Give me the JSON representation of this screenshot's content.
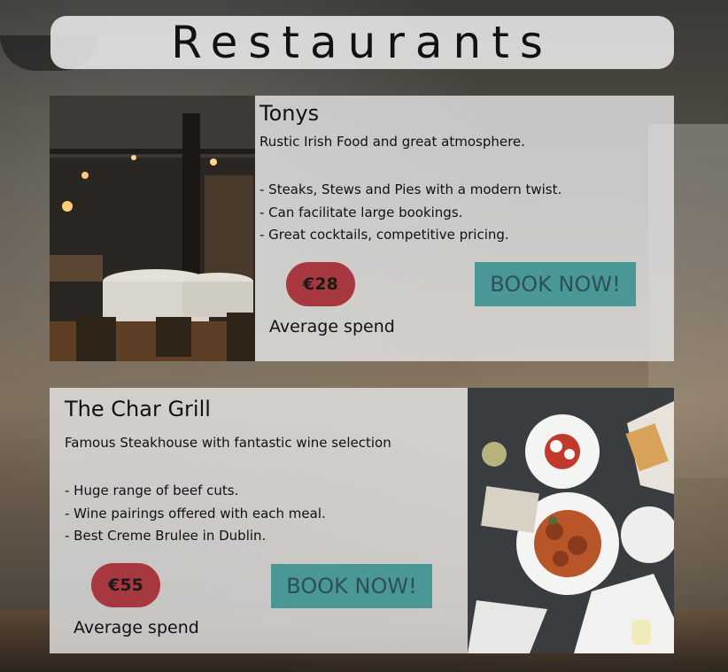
{
  "page": {
    "title": "Restaurants"
  },
  "restaurants": [
    {
      "name": "Tonys",
      "tagline": "Rustic Irish Food and great atmosphere.",
      "features": [
        "- Steaks, Stews and Pies with a modern twist.",
        "- Can facilitate large bookings.",
        "- Great cocktails, competitive pricing."
      ],
      "price": "€28",
      "price_label": "Average spend",
      "book_label": "BOOK NOW!"
    },
    {
      "name": "The Char Grill",
      "tagline": "Famous Steakhouse with fantastic wine selection",
      "features": [
        "- Huge range of beef cuts.",
        "- Wine pairings offered with each meal.",
        "- Best Creme Brulee in Dublin."
      ],
      "price": "€55",
      "price_label": "Average spend",
      "book_label": "BOOK NOW!"
    }
  ],
  "colors": {
    "price_badge": "#a8383f",
    "book_button": "#4a9896",
    "book_button_text": "#2e4f5a"
  }
}
